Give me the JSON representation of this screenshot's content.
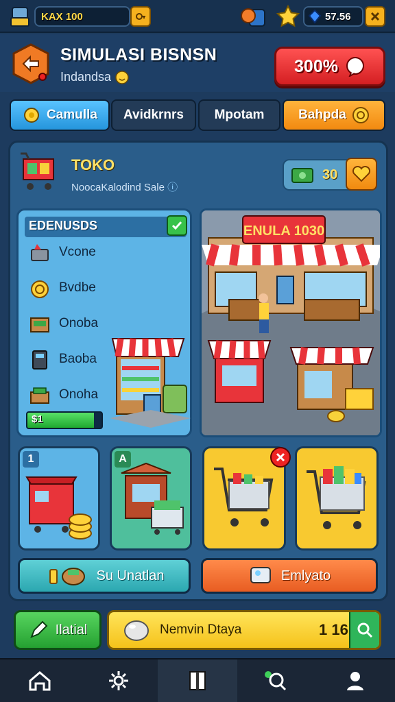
{
  "topbar": {
    "player_label": "KAX 100",
    "gems": "57.56"
  },
  "header": {
    "title": "SIMULASI BISNSN",
    "subtitle": "Indandsa",
    "percent_button": "300%"
  },
  "tabs": [
    {
      "label": "Camulla"
    },
    {
      "label": "Avidkrnrs"
    },
    {
      "label": "Mpotam"
    },
    {
      "label": "Bahpda"
    }
  ],
  "store": {
    "title": "TOKO",
    "subtitle": "NoocaKalodind Sale",
    "cash": "30"
  },
  "list": {
    "header": "EDENUSDS",
    "items": [
      {
        "label": "Vcone",
        "icon": "register-icon"
      },
      {
        "label": "Bvdbe",
        "icon": "coin-icon"
      },
      {
        "label": "Onoba",
        "icon": "cash-crate-icon"
      },
      {
        "label": "Baoba",
        "icon": "card-reader-icon"
      },
      {
        "label": "Onoha",
        "icon": "money-stack-icon"
      }
    ],
    "progress_label": "$1",
    "progress_fraction": 0.9
  },
  "scene": {
    "sign_text": "ENULA 1030"
  },
  "tiles": {
    "tile1_badge": "1",
    "tile2_badge": "A"
  },
  "buttons": {
    "left": "Su Unatlan",
    "right": "Emlyato"
  },
  "actions": {
    "green": "Ilatial",
    "yellow": "Nemvin Dtaya",
    "yellow_count": "1 16"
  },
  "colors": {
    "accent_blue": "#2595dc",
    "accent_orange": "#f28a10",
    "danger_red": "#d41f22",
    "success_green": "#25a031",
    "gold": "#ffe066"
  }
}
